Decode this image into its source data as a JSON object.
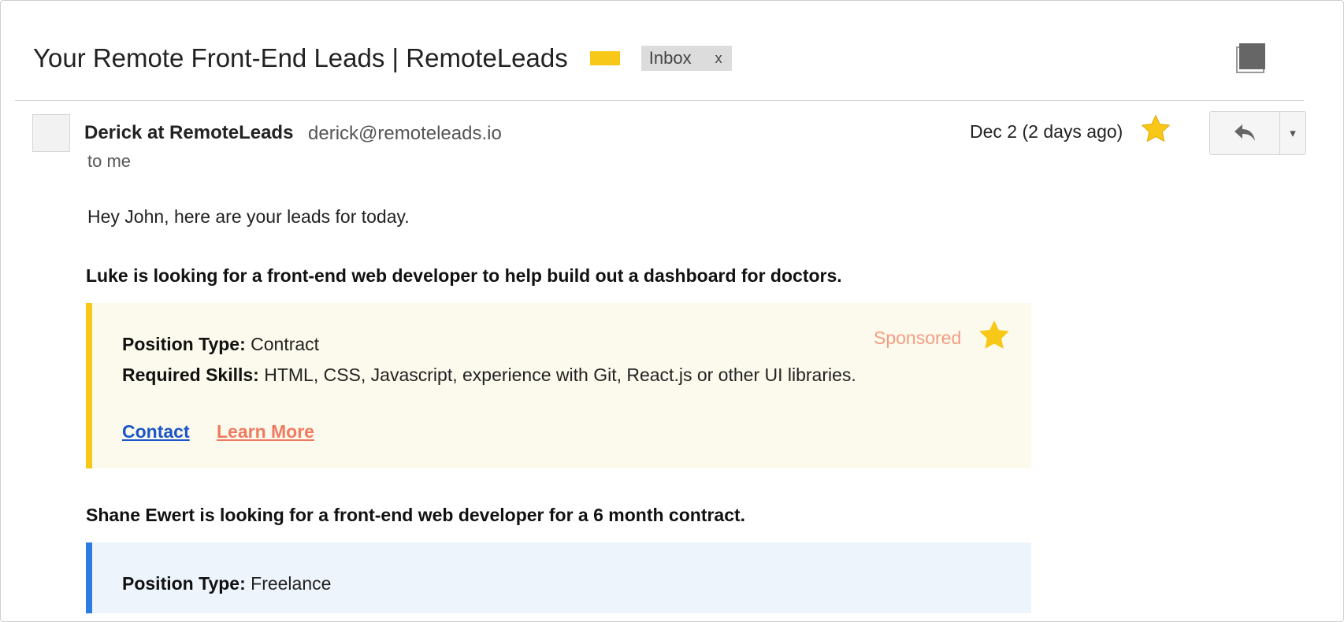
{
  "email": {
    "subject": "Your Remote Front-End Leads | RemoteLeads",
    "label_color": "#f7c817",
    "inbox_chip": {
      "label": "Inbox",
      "remove_label": "x"
    }
  },
  "toolbar": {
    "print_icon": "print-icon"
  },
  "sender": {
    "name": "Derick at RemoteLeads",
    "email": "derick@remoteleads.io",
    "recipient": "to me",
    "date": "Dec 2 (2 days ago)",
    "starred": true,
    "reply_icon": "reply-icon",
    "more_icon": "▾"
  },
  "body": {
    "greeting": "Hey John, here are your leads for today.",
    "leads": [
      {
        "heading": "Luke is looking for a front-end web developer to help build out a dashboard for doctors.",
        "accent_color": "#f7c817",
        "background": "#fcfaec",
        "sponsored_label": "Sponsored",
        "fields": [
          {
            "label": "Position Type:",
            "value": "Contract"
          },
          {
            "label": "Required Skills:",
            "value": "HTML, CSS, Javascript, experience with Git, React.js or other UI libraries."
          }
        ],
        "links": [
          {
            "label": "Contact",
            "color": "#1a56c9"
          },
          {
            "label": "Learn More",
            "color": "#f07a60"
          }
        ]
      },
      {
        "heading": "Shane Ewert is looking for a front-end web developer for a 6 month contract.",
        "accent_color": "#2d7be0",
        "background": "#edf4fc",
        "fields": [
          {
            "label": "Position Type:",
            "value": "Freelance"
          }
        ]
      }
    ]
  }
}
